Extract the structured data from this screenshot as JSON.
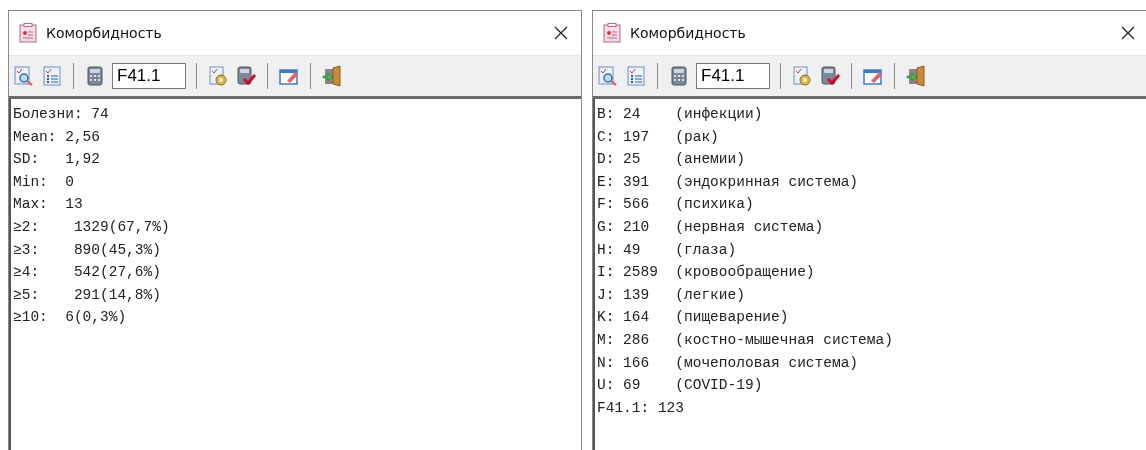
{
  "windows": [
    {
      "title": "Коморбидность",
      "code_field": {
        "value": "F41.1"
      },
      "lines": [
        "Болезни: 74",
        "Mean: 2,56",
        "SD:   1,92",
        "Min:  0",
        "Max:  13",
        "≥2:    1329(67,7%)",
        "≥3:    890(45,3%)",
        "≥4:    542(27,6%)",
        "≥5:    291(14,8%)",
        "≥10:  6(0,3%)"
      ]
    },
    {
      "title": "Коморбидность",
      "code_field": {
        "value": "F41.1"
      },
      "lines": [
        "B: 24    (инфекции)",
        "C: 197   (рак)",
        "D: 25    (анемии)",
        "E: 391   (эндокринная система)",
        "F: 566   (психика)",
        "G: 210   (нервная система)",
        "H: 49    (глаза)",
        "I: 2589  (кровообращение)",
        "J: 139   (легкие)",
        "K: 164   (пищеварение)",
        "M: 286   (костно-мышечная система)",
        "N: 166   (мочеполовая система)",
        "U: 69    (COVID-19)",
        "F41.1: 123"
      ]
    }
  ]
}
